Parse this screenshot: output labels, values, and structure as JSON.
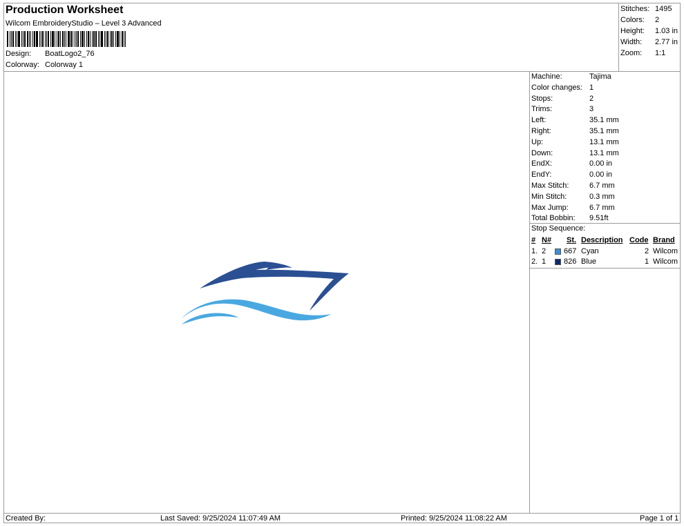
{
  "header": {
    "title": "Production Worksheet",
    "subtitle": "Wilcom EmbroideryStudio – Level 3 Advanced",
    "design_label": "Design:",
    "design_value": "BoatLogo2_76",
    "colorway_label": "Colorway:",
    "colorway_value": "Colorway 1"
  },
  "summary": [
    {
      "label": "Stitches:",
      "value": "1495"
    },
    {
      "label": "Colors:",
      "value": "2"
    },
    {
      "label": "Height:",
      "value": "1.03 in"
    },
    {
      "label": "Width:",
      "value": "2.77 in"
    },
    {
      "label": "Zoom:",
      "value": "1:1"
    }
  ],
  "properties": [
    {
      "label": "Machine:",
      "value": "Tajima"
    },
    {
      "label": "Color changes:",
      "value": "1"
    },
    {
      "label": "Stops:",
      "value": "2"
    },
    {
      "label": "Trims:",
      "value": "3"
    },
    {
      "label": "Left:",
      "value": "35.1 mm"
    },
    {
      "label": "Right:",
      "value": "35.1 mm"
    },
    {
      "label": "Up:",
      "value": "13.1 mm"
    },
    {
      "label": "Down:",
      "value": "13.1 mm"
    },
    {
      "label": "EndX:",
      "value": "0.00 in"
    },
    {
      "label": "EndY:",
      "value": "0.00 in"
    },
    {
      "label": "Max Stitch:",
      "value": "6.7 mm"
    },
    {
      "label": "Min Stitch:",
      "value": "0.3 mm"
    },
    {
      "label": "Max Jump:",
      "value": "6.7 mm"
    },
    {
      "label": "Total Bobbin:",
      "value": "9.51ft"
    }
  ],
  "stop_sequence": {
    "title": "Stop Sequence:",
    "headers": {
      "num": "#",
      "n": "N#",
      "st": "St.",
      "description": "Description",
      "code": "Code",
      "brand": "Brand"
    },
    "rows": [
      {
        "num": "1.",
        "n": "2",
        "color": "#3a8fd9",
        "st": "667",
        "description": "Cyan",
        "code": "2",
        "brand": "Wilcom"
      },
      {
        "num": "2.",
        "n": "1",
        "color": "#0b2a6b",
        "st": "826",
        "description": "Blue",
        "code": "1",
        "brand": "Wilcom"
      }
    ]
  },
  "design_colors": {
    "boat": "#2b4f93",
    "waves": "#4aa8e0"
  },
  "footer": {
    "created_by": "Created By:",
    "last_saved": "Last Saved: 9/25/2024 11:07:49 AM",
    "printed": "Printed: 9/25/2024 11:08:22 AM",
    "page": "Page 1 of 1"
  }
}
